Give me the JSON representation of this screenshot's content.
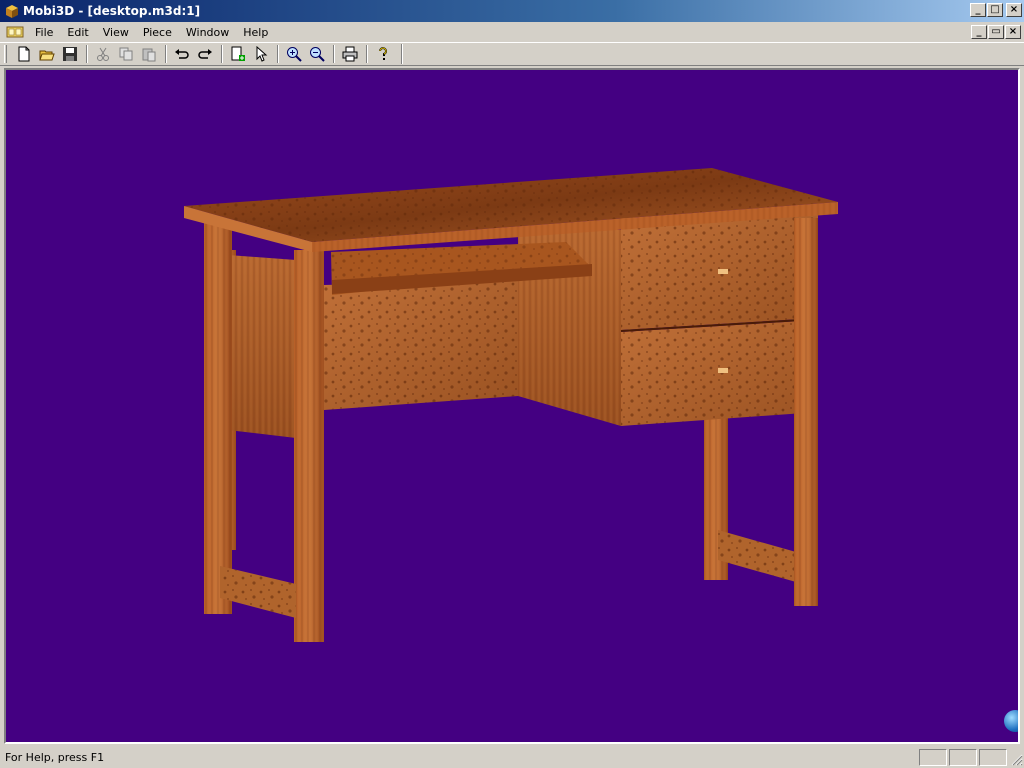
{
  "window": {
    "title": "Mobi3D - [desktop.m3d:1]",
    "buttons": {
      "minimize": "_",
      "maximize": "□",
      "close": "×"
    }
  },
  "menubar": {
    "items": [
      "File",
      "Edit",
      "View",
      "Piece",
      "Window",
      "Help"
    ]
  },
  "mdi": {
    "buttons": {
      "minimize": "_",
      "restore": "▭",
      "close": "×"
    }
  },
  "toolbar": {
    "buttons": [
      {
        "name": "new-icon",
        "group": 1
      },
      {
        "name": "open-icon",
        "group": 1
      },
      {
        "name": "save-icon",
        "group": 1
      },
      {
        "name": "cut-icon",
        "group": 2,
        "disabled": true
      },
      {
        "name": "copy-icon",
        "group": 2,
        "disabled": true
      },
      {
        "name": "paste-icon",
        "group": 2,
        "disabled": true
      },
      {
        "name": "undo-icon",
        "group": 3
      },
      {
        "name": "redo-icon",
        "group": 3
      },
      {
        "name": "add-piece-icon",
        "group": 4
      },
      {
        "name": "select-arrow-icon",
        "group": 4
      },
      {
        "name": "zoom-in-icon",
        "group": 5
      },
      {
        "name": "zoom-out-icon",
        "group": 5
      },
      {
        "name": "print-icon",
        "group": 6
      },
      {
        "name": "help-icon",
        "group": 7
      }
    ]
  },
  "viewport": {
    "background": "#440082",
    "model": "desk"
  },
  "statusbar": {
    "text": "For Help, press F1"
  },
  "colors": {
    "titlebar_start": "#0a246a",
    "titlebar_end": "#a6caf0",
    "wood_dark": "#7a3a12",
    "wood_mid": "#a8501c",
    "wood_light": "#c8743a"
  }
}
